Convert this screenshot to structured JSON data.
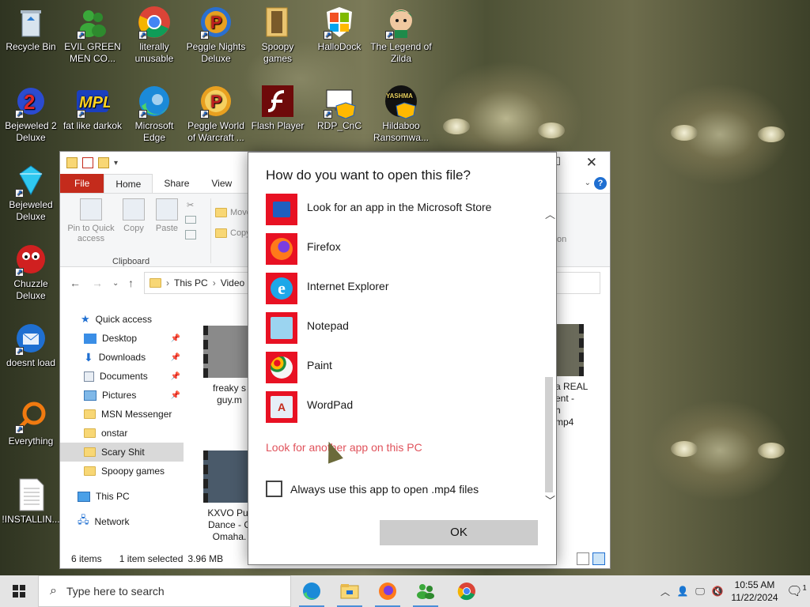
{
  "desktop": {
    "icons": [
      {
        "label": "Recycle Bin",
        "icon": "recycle-bin-icon"
      },
      {
        "label": "EVIL GREEN MEN CO...",
        "icon": "green-men-icon"
      },
      {
        "label": "literally unusable",
        "icon": "chrome-icon"
      },
      {
        "label": "Peggle Nights Deluxe",
        "icon": "peggle-icon"
      },
      {
        "label": "Spoopy games",
        "icon": "folder-icon"
      },
      {
        "label": "HalloDock",
        "icon": "windows-shield-icon"
      },
      {
        "label": "The Legend of Zilda",
        "icon": "zelda-icon"
      },
      {
        "label": "Bejeweled 2 Deluxe",
        "icon": "bejeweled2-icon"
      },
      {
        "label": "fat like darkok",
        "icon": "mpl-icon"
      },
      {
        "label": "Microsoft Edge",
        "icon": "edge-icon"
      },
      {
        "label": "Peggle World of Warcraft ...",
        "icon": "peggle-wow-icon"
      },
      {
        "label": "Flash Player",
        "icon": "flash-icon"
      },
      {
        "label": "RDP_CnC",
        "icon": "rdp-icon"
      },
      {
        "label": "Hildaboo Ransomwa...",
        "icon": "yashma-icon",
        "logo_text": "YASHMA"
      },
      {
        "label": "Bejeweled Deluxe",
        "icon": "diamond-icon"
      },
      {
        "label": "Chuzzle Deluxe",
        "icon": "chuzzle-icon"
      },
      {
        "label": "doesnt load",
        "icon": "thunderbird-icon"
      },
      {
        "label": "Everything",
        "icon": "everything-search-icon"
      },
      {
        "label": "!INSTALLIN...",
        "icon": "text-file-icon"
      }
    ]
  },
  "explorer": {
    "ribbon_tabs": [
      "File",
      "Home",
      "Share",
      "View"
    ],
    "ribbon_buttons": {
      "pin": "Pin to Quick access",
      "copy": "Copy",
      "paste": "Paste",
      "group_clipboard": "Clipboard",
      "move": "Move",
      "copy_to": "Copy",
      "partial_on": "on"
    },
    "breadcrumb": [
      "This PC",
      "Video"
    ],
    "nav": [
      {
        "label": "Quick access",
        "icon": "star-icon"
      },
      {
        "label": "Desktop",
        "icon": "desktop-icon"
      },
      {
        "label": "Downloads",
        "icon": "download-icon"
      },
      {
        "label": "Documents",
        "icon": "documents-icon"
      },
      {
        "label": "Pictures",
        "icon": "pictures-icon"
      },
      {
        "label": "MSN Messenger",
        "icon": "folder-icon"
      },
      {
        "label": "onstar",
        "icon": "folder-icon"
      },
      {
        "label": "Scary Shit",
        "icon": "folder-icon"
      },
      {
        "label": "Spoopy games",
        "icon": "folder-icon"
      },
      {
        "label": "This PC",
        "icon": "computer-icon"
      },
      {
        "label": "Network",
        "icon": "network-icon"
      }
    ],
    "files": [
      {
        "line1": "freaky s",
        "line2": "guy.m"
      },
      {
        "line1": "KXVO Pur",
        "line2": "Dance - C",
        "line3": "Omaha."
      },
      {
        "line1": "a REAL",
        "line2": "ent -",
        "line3": "h",
        "line4": "mp4"
      }
    ],
    "status": {
      "items": "6 items",
      "selected": "1 item selected",
      "size": "3.96 MB"
    }
  },
  "dialog": {
    "title": "How do you want to open this file?",
    "apps": [
      {
        "name": "Look for an app in the Microsoft Store",
        "icon": "store-icon",
        "color": "#1f5fbf"
      },
      {
        "name": "Firefox",
        "icon": "firefox-icon",
        "color": "#ff7a1a"
      },
      {
        "name": "Internet Explorer",
        "icon": "internet-explorer-icon",
        "color": "#1ea7e8"
      },
      {
        "name": "Notepad",
        "icon": "notepad-icon",
        "color": "#9bd4f0"
      },
      {
        "name": "Paint",
        "icon": "paint-icon",
        "color": "#f5f5f5"
      },
      {
        "name": "WordPad",
        "icon": "wordpad-icon",
        "color": "#e6eef7"
      }
    ],
    "other_link": "Look for another app on this PC",
    "checkbox_label": "Always use this app to open .mp4 files",
    "ok": "OK"
  },
  "taskbar": {
    "search_placeholder": "Type here to search",
    "pinned": [
      "edge-icon",
      "file-explorer-icon",
      "firefox-icon",
      "green-men-icon",
      "chrome-icon"
    ],
    "time": "10:55 AM",
    "date": "11/22/2024",
    "notification_count": "1"
  }
}
